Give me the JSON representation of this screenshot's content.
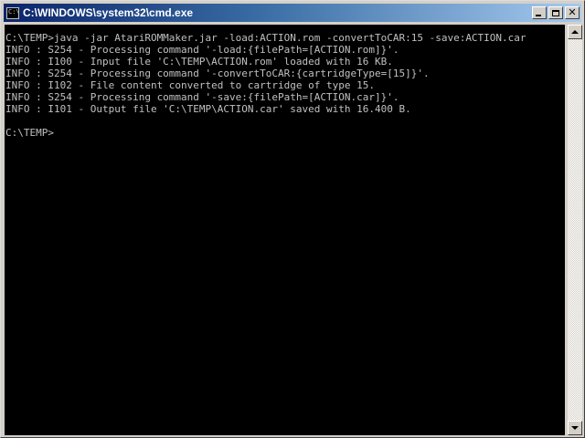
{
  "window": {
    "title": "C:\\WINDOWS\\system32\\cmd.exe",
    "icon_label": "C:\\"
  },
  "controls": {
    "minimize": "minimize",
    "maximize": "maximize",
    "close": "✕"
  },
  "console": {
    "lines": [
      "C:\\TEMP>java -jar AtariROMMaker.jar -load:ACTION.rom -convertToCAR:15 -save:ACTION.car",
      "INFO : S254 - Processing command '-load:{filePath=[ACTION.rom]}'.",
      "INFO : I100 - Input file 'C:\\TEMP\\ACTION.rom' loaded with 16 KB.",
      "INFO : S254 - Processing command '-convertToCAR:{cartridgeType=[15]}'.",
      "INFO : I102 - File content converted to cartridge of type 15.",
      "INFO : S254 - Processing command '-save:{filePath=[ACTION.car]}'.",
      "INFO : I101 - Output file 'C:\\TEMP\\ACTION.car' saved with 16.400 B.",
      "",
      "C:\\TEMP>"
    ],
    "text_color": "#c0c0c0",
    "background_color": "#000000"
  }
}
